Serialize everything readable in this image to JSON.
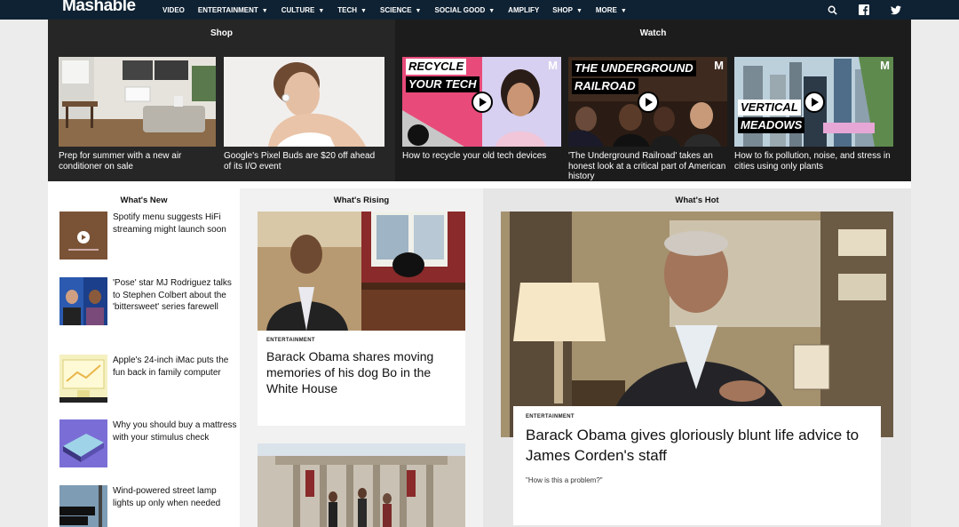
{
  "nav": {
    "logo": "Mashable",
    "items": [
      {
        "label": "VIDEO",
        "caret": ""
      },
      {
        "label": "ENTERTAINMENT",
        "caret": "▼"
      },
      {
        "label": "CULTURE",
        "caret": "▼"
      },
      {
        "label": "TECH",
        "caret": "▼"
      },
      {
        "label": "SCIENCE",
        "caret": "▼"
      },
      {
        "label": "SOCIAL GOOD",
        "caret": "▼"
      },
      {
        "label": "AMPLIFY",
        "caret": ""
      },
      {
        "label": "SHOP",
        "caret": "▼"
      },
      {
        "label": "MORE",
        "caret": "▼"
      }
    ],
    "icons": [
      "search-icon",
      "facebook-icon",
      "twitter-icon"
    ]
  },
  "shop": {
    "title": "Shop",
    "cards": [
      {
        "caption": "Prep for summer with a new air conditioner on sale"
      },
      {
        "caption": "Google's Pixel Buds are $20 off ahead of its I/O event"
      }
    ]
  },
  "watch": {
    "title": "Watch",
    "badge": "M",
    "cards": [
      {
        "caption": "How to recycle your old tech devices",
        "overlay": [
          "RECYCLE",
          "YOUR TECH"
        ]
      },
      {
        "caption": "'The Underground Railroad' takes an honest look at a critical part of American history",
        "overlay": [
          "THE UNDERGROUND",
          "RAILROAD"
        ]
      },
      {
        "caption": "How to fix pollution, noise, and stress in cities using only plants",
        "overlay": [
          "VERTICAL",
          "MEADOWS"
        ]
      }
    ]
  },
  "whats_new": {
    "title": "What's New",
    "items": [
      {
        "text": "Spotify menu suggests HiFi streaming might launch soon"
      },
      {
        "text": "'Pose' star MJ Rodriguez talks to Stephen Colbert about the 'bittersweet' series farewell"
      },
      {
        "text": "Apple's 24-inch iMac puts the fun back in family computer"
      },
      {
        "text": "Why you should buy a mattress with your stimulus check"
      },
      {
        "text": "Wind-powered street lamp lights up only when needed"
      }
    ]
  },
  "whats_rising": {
    "title": "What's Rising",
    "cards": [
      {
        "kicker": "ENTERTAINMENT",
        "headline": "Barack Obama shares moving memories of his dog Bo in the White House"
      }
    ]
  },
  "whats_hot": {
    "title": "What's Hot",
    "kicker": "ENTERTAINMENT",
    "headline": "Barack Obama gives gloriously blunt life advice to James Corden's staff",
    "subtitle": "\"How is this a problem?\""
  }
}
